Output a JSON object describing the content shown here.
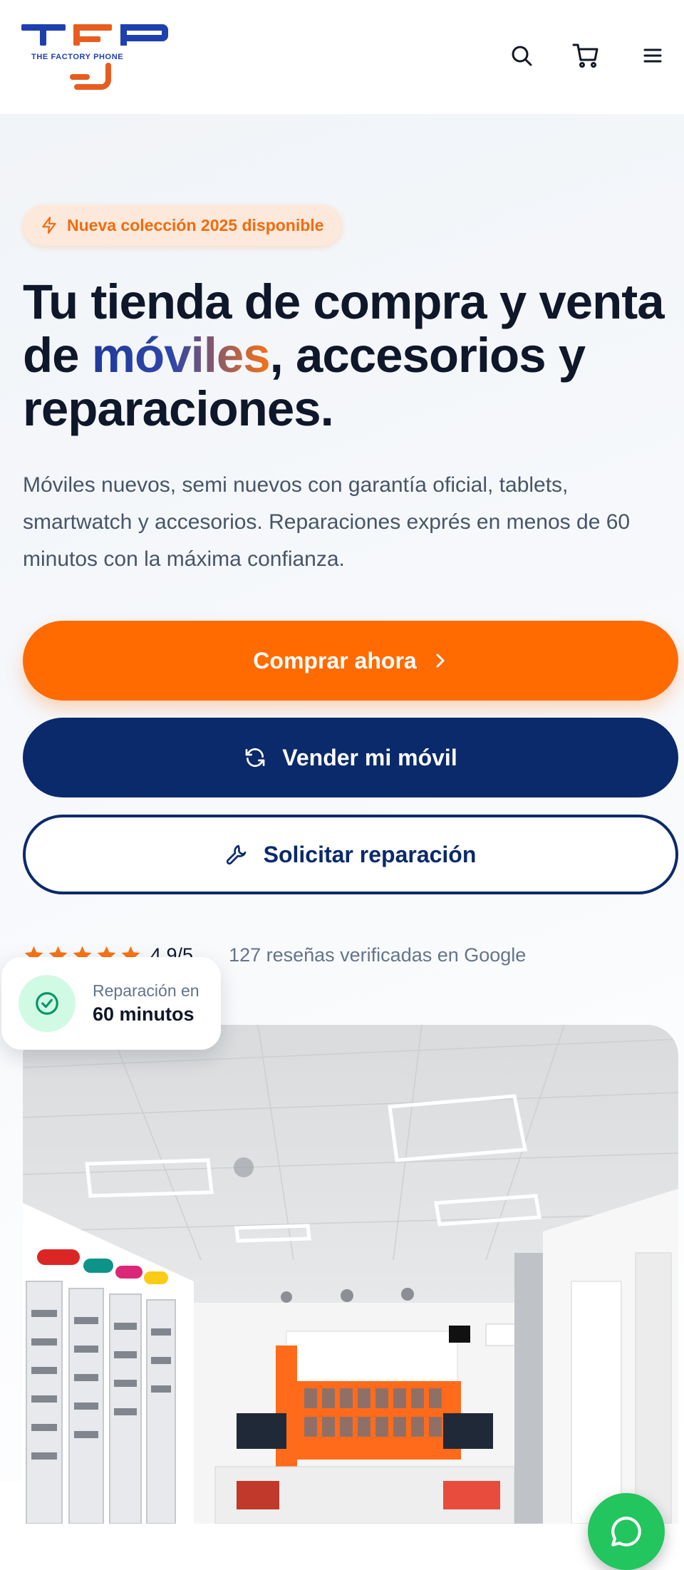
{
  "header": {
    "logo_letters": "TFP",
    "logo_tagline": "THE FACTORY PHONE",
    "icons": [
      "search-icon",
      "cart-icon",
      "menu-icon"
    ]
  },
  "hero": {
    "badge_text": "Nueva colección 2025 disponible",
    "headline_part1": "Tu tienda de compra y venta de ",
    "headline_highlight": "móviles",
    "headline_part2": ", accesorios y reparaciones.",
    "subtext": "Móviles nuevos, semi nuevos con garantía oficial, tablets, smartwatch y accesorios. Reparaciones exprés en menos de 60 minutos con la máxima confianza.",
    "buttons": {
      "buy": "Comprar ahora",
      "sell": "Vender mi móvil",
      "repair": "Solicitar reparación"
    },
    "rating": {
      "stars": 5,
      "score": "4.9/5",
      "reviews_text": "127 reseñas verificadas en Google"
    },
    "floating_card": {
      "label": "Reparación en",
      "value": "60 minutos"
    }
  },
  "colors": {
    "orange": "#ff6b00",
    "navy": "#0b2a6b",
    "whatsapp_green": "#22c55e"
  }
}
